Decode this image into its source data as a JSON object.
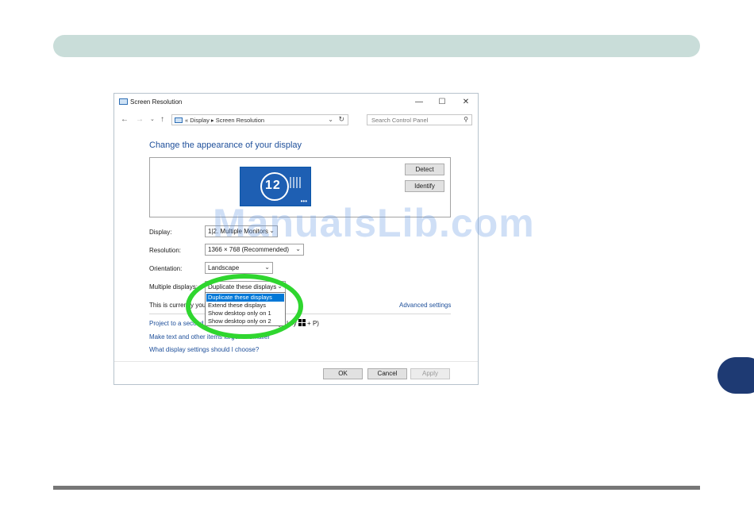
{
  "window": {
    "title": "Screen Resolution",
    "controls": {
      "minimize": "—",
      "maximize": "☐",
      "close": "✕"
    }
  },
  "nav": {
    "back": "←",
    "forward": "→",
    "recent": "⌄",
    "up": "↑",
    "breadcrumb": "« Display ▸ Screen Resolution",
    "address_dropdown": "⌄",
    "refresh": "↻",
    "search_placeholder": "Search Control Panel",
    "search_icon": "⚲"
  },
  "main": {
    "heading": "Change the appearance of your display",
    "monitor_label": "12",
    "monitor_dots": "•••",
    "detect_button": "Detect",
    "identify_button": "Identify",
    "display_label": "Display:",
    "display_value": "1|2. Multiple Monitors",
    "resolution_label": "Resolution:",
    "resolution_value": "1366 × 768 (Recommended)",
    "orientation_label": "Orientation:",
    "orientation_value": "Landscape",
    "multiple_label": "Multiple displays:",
    "multiple_value": "Duplicate these displays",
    "multiple_options": [
      "Duplicate these displays",
      "Extend these displays",
      "Show desktop only on 1",
      "Show desktop only on 2"
    ],
    "info_text": "This is currently your",
    "advanced_link": "Advanced settings",
    "project_link": "Project to a second screen",
    "win_key_text": "go key",
    "win_key_suffix": "+ P)",
    "text_size_link": "Make text and other items larger or smaller",
    "help_link": "What display settings should I choose?"
  },
  "footer": {
    "ok": "OK",
    "cancel": "Cancel",
    "apply": "Apply"
  },
  "watermark": "ManualsLib.com",
  "colors": {
    "page_header": "#c9ddd9",
    "side_tab": "#1e3a73",
    "highlight_ring": "#2fd62f",
    "accent_link": "#1e4f9a",
    "selection": "#0078d7"
  }
}
